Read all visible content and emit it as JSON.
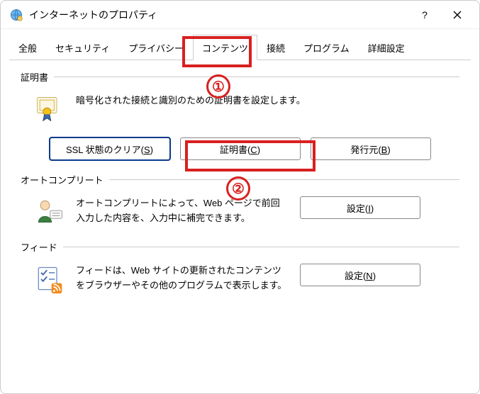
{
  "window": {
    "title": "インターネットのプロパティ"
  },
  "tabs": {
    "general": "全般",
    "security": "セキュリティ",
    "privacy": "プライバシー",
    "content": "コンテンツ",
    "connections": "接続",
    "programs": "プログラム",
    "advanced": "詳細設定",
    "activeIndex": 3
  },
  "groups": {
    "certificates": {
      "title": "証明書",
      "desc": "暗号化された接続と識別のための証明書を設定します。",
      "btnClearSSL": "SSL 状態のクリア(S)",
      "btnCertificates": "証明書(C)",
      "btnPublishers": "発行元(B)"
    },
    "autocomplete": {
      "title": "オートコンプリート",
      "desc": "オートコンプリートによって、Web ページで前回入力した内容を、入力中に補完できます。",
      "btnSettings": "設定(I)"
    },
    "feeds": {
      "title": "フィード",
      "desc": "フィードは、Web サイトの更新されたコンテンツをブラウザーやその他のプログラムで表示します。",
      "btnSettings": "設定(N)"
    }
  },
  "annotations": {
    "callout1": "①",
    "callout2": "②",
    "highlightColor": "#d92020"
  }
}
